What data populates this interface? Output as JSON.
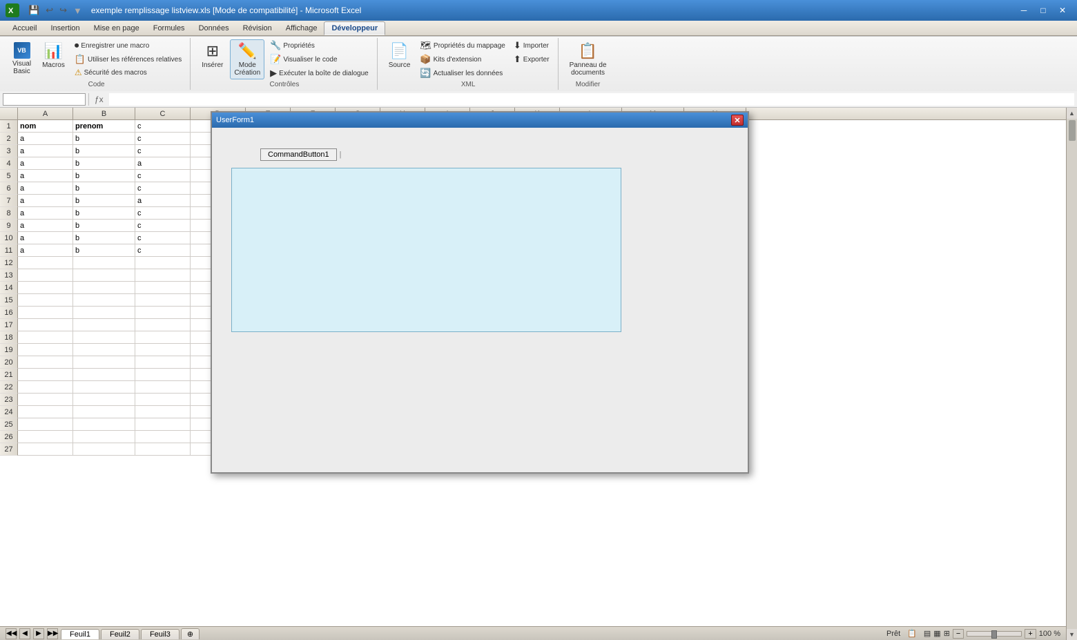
{
  "titleBar": {
    "title": "exemple remplissage listview.xls [Mode de compatibilité] - Microsoft Excel",
    "icon": "X"
  },
  "menuBar": {
    "items": [
      "Accueil",
      "Insertion",
      "Mise en page",
      "Formules",
      "Données",
      "Révision",
      "Affichage",
      "Développeur"
    ]
  },
  "ribbon": {
    "activeTab": "Développeur",
    "groups": [
      {
        "name": "Code",
        "label": "Code",
        "buttons": [
          {
            "id": "visual-basic",
            "label": "Visual\nBasic",
            "icon": "VB"
          },
          {
            "id": "macros",
            "label": "Macros",
            "icon": "▶"
          }
        ],
        "smallButtons": [
          {
            "id": "enregistrer-macro",
            "label": "Enregistrer une macro"
          },
          {
            "id": "references-relatives",
            "label": "Utiliser les références relatives"
          },
          {
            "id": "securite-macros",
            "label": "Sécurité des macros",
            "hasWarning": true
          }
        ]
      },
      {
        "name": "Contrôles",
        "label": "Contrôles",
        "buttons": [
          {
            "id": "inserer",
            "label": "Insérer",
            "icon": "⊞"
          },
          {
            "id": "mode-creation",
            "label": "Mode\nCréation",
            "icon": "✏"
          }
        ],
        "smallButtons": [
          {
            "id": "proprietes",
            "label": "Propriétés"
          },
          {
            "id": "visualiser-code",
            "label": "Visualiser le code"
          },
          {
            "id": "executer-boite",
            "label": "Exécuter la boîte de dialogue"
          }
        ]
      },
      {
        "name": "XML",
        "label": "XML",
        "buttons": [
          {
            "id": "source",
            "label": "Source",
            "icon": "📄"
          }
        ],
        "smallButtons": [
          {
            "id": "proprietes-mappage",
            "label": "Propriétés du mappage"
          },
          {
            "id": "kits-extension",
            "label": "Kits d'extension"
          },
          {
            "id": "actualiser-donnees",
            "label": "Actualiser les données"
          },
          {
            "id": "importer",
            "label": "Importer"
          },
          {
            "id": "exporter",
            "label": "Exporter"
          }
        ]
      },
      {
        "name": "Modifier",
        "label": "Modifier",
        "buttons": [
          {
            "id": "panneau-documents",
            "label": "Panneau de\ndocuments",
            "icon": "📋"
          }
        ]
      }
    ]
  },
  "formulaBar": {
    "nameBox": "",
    "formula": ""
  },
  "spreadsheet": {
    "columns": [
      "A",
      "B",
      "C",
      "D",
      "E",
      "F",
      "G",
      "H",
      "I",
      "J",
      "K",
      "L",
      "M",
      "N"
    ],
    "rows": [
      {
        "num": 1,
        "cells": [
          "nom",
          "prenom",
          "c",
          "",
          "",
          "",
          "",
          "",
          "",
          "",
          "",
          "",
          "",
          ""
        ]
      },
      {
        "num": 2,
        "cells": [
          "a",
          "b",
          "c",
          "",
          "",
          "",
          "",
          "",
          "",
          "",
          "",
          "",
          "",
          ""
        ]
      },
      {
        "num": 3,
        "cells": [
          "a",
          "b",
          "c",
          "",
          "",
          "",
          "",
          "",
          "",
          "",
          "",
          "",
          "",
          ""
        ]
      },
      {
        "num": 4,
        "cells": [
          "a",
          "b",
          "a",
          "",
          "",
          "",
          "",
          "",
          "",
          "",
          "",
          "",
          "",
          ""
        ]
      },
      {
        "num": 5,
        "cells": [
          "a",
          "b",
          "c",
          "",
          "",
          "",
          "",
          "",
          "",
          "",
          "",
          "",
          "",
          ""
        ]
      },
      {
        "num": 6,
        "cells": [
          "a",
          "b",
          "c",
          "",
          "",
          "",
          "",
          "",
          "",
          "",
          "",
          "",
          "",
          ""
        ]
      },
      {
        "num": 7,
        "cells": [
          "a",
          "b",
          "a",
          "",
          "",
          "",
          "",
          "",
          "",
          "",
          "",
          "",
          "",
          ""
        ]
      },
      {
        "num": 8,
        "cells": [
          "a",
          "b",
          "c",
          "",
          "",
          "",
          "",
          "",
          "",
          "",
          "",
          "",
          "",
          ""
        ]
      },
      {
        "num": 9,
        "cells": [
          "a",
          "b",
          "c",
          "",
          "",
          "",
          "",
          "",
          "",
          "",
          "",
          "",
          "",
          ""
        ]
      },
      {
        "num": 10,
        "cells": [
          "a",
          "b",
          "c",
          "",
          "",
          "",
          "",
          "",
          "",
          "",
          "",
          "",
          "",
          ""
        ]
      },
      {
        "num": 11,
        "cells": [
          "a",
          "b",
          "c",
          "",
          "",
          "",
          "",
          "",
          "",
          "",
          "",
          "",
          "",
          ""
        ]
      },
      {
        "num": 12,
        "cells": [
          "",
          "",
          "",
          "",
          "",
          "",
          "",
          "",
          "",
          "",
          "",
          "",
          "",
          ""
        ]
      },
      {
        "num": 13,
        "cells": [
          "",
          "",
          "",
          "",
          "",
          "",
          "",
          "",
          "",
          "",
          "",
          "",
          "",
          ""
        ]
      },
      {
        "num": 14,
        "cells": [
          "",
          "",
          "",
          "",
          "",
          "",
          "",
          "",
          "",
          "",
          "",
          "",
          "",
          ""
        ]
      },
      {
        "num": 15,
        "cells": [
          "",
          "",
          "",
          "",
          "",
          "",
          "",
          "",
          "",
          "",
          "",
          "",
          "",
          ""
        ]
      },
      {
        "num": 16,
        "cells": [
          "",
          "",
          "",
          "",
          "",
          "",
          "",
          "",
          "",
          "",
          "",
          "",
          "",
          ""
        ]
      },
      {
        "num": 17,
        "cells": [
          "",
          "",
          "",
          "",
          "",
          "",
          "",
          "",
          "",
          "",
          "",
          "",
          "",
          ""
        ]
      },
      {
        "num": 18,
        "cells": [
          "",
          "",
          "",
          "",
          "",
          "",
          "",
          "",
          "",
          "",
          "",
          "",
          "",
          ""
        ]
      },
      {
        "num": 19,
        "cells": [
          "",
          "",
          "",
          "",
          "",
          "",
          "",
          "",
          "",
          "",
          "",
          "",
          "",
          ""
        ]
      },
      {
        "num": 20,
        "cells": [
          "",
          "",
          "",
          "",
          "",
          "",
          "",
          "",
          "",
          "",
          "",
          "",
          "",
          ""
        ]
      },
      {
        "num": 21,
        "cells": [
          "",
          "",
          "",
          "",
          "",
          "",
          "",
          "",
          "",
          "",
          "",
          "",
          "",
          ""
        ]
      },
      {
        "num": 22,
        "cells": [
          "",
          "",
          "",
          "",
          "",
          "",
          "",
          "",
          "",
          "",
          "",
          "",
          "",
          ""
        ]
      },
      {
        "num": 23,
        "cells": [
          "",
          "",
          "",
          "",
          "",
          "",
          "",
          "",
          "",
          "",
          "",
          "",
          "",
          ""
        ]
      },
      {
        "num": 24,
        "cells": [
          "",
          "",
          "",
          "",
          "",
          "",
          "",
          "",
          "",
          "",
          "",
          "",
          "",
          ""
        ]
      },
      {
        "num": 25,
        "cells": [
          "",
          "",
          "",
          "",
          "",
          "",
          "",
          "",
          "",
          "",
          "",
          "",
          "",
          ""
        ]
      },
      {
        "num": 26,
        "cells": [
          "",
          "",
          "",
          "",
          "",
          "",
          "",
          "",
          "",
          "",
          "",
          "",
          "",
          ""
        ]
      },
      {
        "num": 27,
        "cells": [
          "",
          "",
          "",
          "",
          "",
          "",
          "",
          "",
          "",
          "",
          "",
          "",
          "",
          ""
        ]
      }
    ]
  },
  "dialog": {
    "title": "UserForm1",
    "closeBtn": "✕",
    "commandButton": "CommandButton1",
    "listbox": {
      "background": "#d8f0f8"
    }
  },
  "sheets": {
    "tabs": [
      "Feuil1",
      "Feuil2",
      "Feuil3"
    ],
    "active": "Feuil1"
  },
  "statusBar": {
    "ready": "Prêt",
    "zoom": "100 %",
    "icons": [
      "normal-view",
      "page-layout-view",
      "page-break-view"
    ]
  }
}
